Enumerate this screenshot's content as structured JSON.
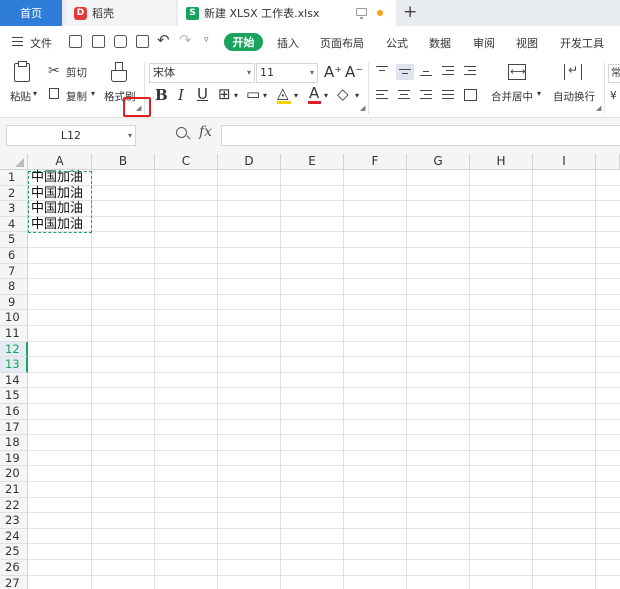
{
  "tabs": {
    "home": "首页",
    "daoke": "稻壳",
    "daoke_logo": "D",
    "workbook": "新建 XLSX 工作表.xlsx",
    "workbook_logo": "S"
  },
  "menu": {
    "file": "文件",
    "start": "开始",
    "items": [
      "插入",
      "页面布局",
      "公式",
      "数据",
      "审阅",
      "视图",
      "开发工具"
    ]
  },
  "ribbon": {
    "paste": "粘贴",
    "cut": "剪切",
    "copy": "复制",
    "format_painter": "格式刷",
    "font_name": "宋体",
    "font_size": "11",
    "merge_center": "合并居中",
    "wrap_text": "自动换行",
    "overflow_label": "常",
    "grow_font": "A⁺",
    "shrink_font": "A⁻"
  },
  "formula_bar": {
    "name_box": "L12",
    "fx": "fx",
    "value": ""
  },
  "sheet": {
    "columns": [
      "A",
      "B",
      "C",
      "D",
      "E",
      "F",
      "G",
      "H",
      "I"
    ],
    "rows": [
      "1",
      "2",
      "3",
      "4",
      "5",
      "6",
      "7",
      "8",
      "9",
      "10",
      "11",
      "12",
      "13",
      "14",
      "15",
      "16",
      "17",
      "18",
      "19",
      "20",
      "21",
      "22",
      "23",
      "24",
      "25",
      "26",
      "27"
    ],
    "selected_rows": [
      "12",
      "13"
    ],
    "cells": {
      "A1": "中国加油",
      "A2": "中国加油",
      "A3": "中国加油",
      "A4": "中国加油"
    }
  },
  "colors": {
    "accent": "#1aa35c",
    "home_tab": "#2f7dd8",
    "highlight": "#e02020",
    "font_color_bar": "#e02020",
    "fill_color_bar": "#f5d300"
  }
}
